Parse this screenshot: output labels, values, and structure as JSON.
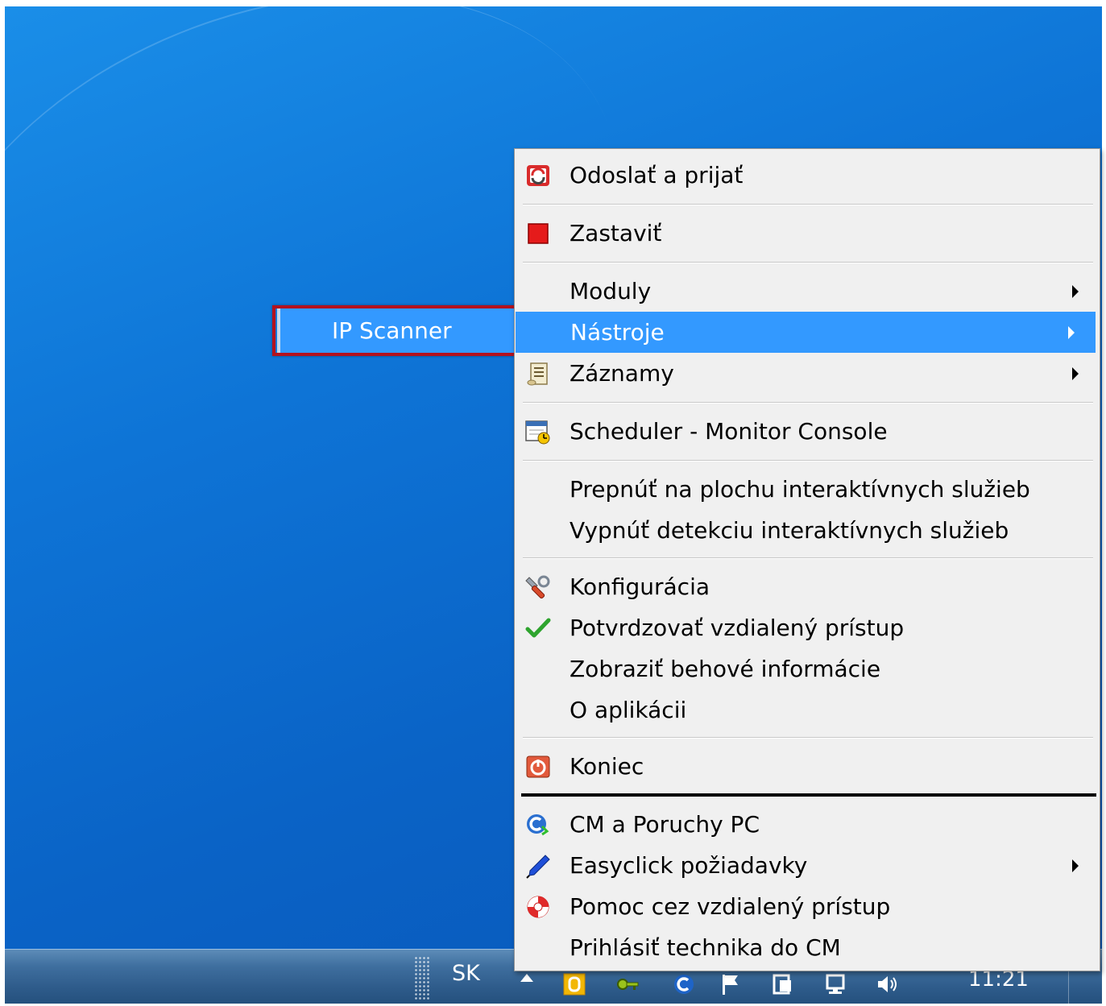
{
  "desktop": {
    "colors": {
      "background": "#0e74d6",
      "menu_bg": "#f0f0f0",
      "highlight": "#3399ff",
      "callout": "#b3121e"
    }
  },
  "taskbar": {
    "language": "SK",
    "clock": "11:21",
    "tray_icons": [
      "office-tray-icon",
      "key-tray-icon",
      "c-tray-icon",
      "flag-tray-icon",
      "device-tray-icon",
      "network-tray-icon",
      "volume-tray-icon"
    ]
  },
  "context_menu": {
    "items": [
      {
        "label": "Odoslať a prijať",
        "icon": "send-receive-icon"
      },
      {
        "label": "Zastaviť",
        "icon": "stop-icon"
      },
      {
        "label": "Moduly",
        "submenu": true
      },
      {
        "label": "Nástroje",
        "submenu": true,
        "highlighted": true
      },
      {
        "label": "Záznamy",
        "icon": "scroll-icon",
        "submenu": true
      },
      {
        "label": "Scheduler - Monitor Console",
        "icon": "scheduler-icon"
      },
      {
        "label": "Prepnúť na plochu interaktívnych služieb"
      },
      {
        "label": "Vypnúť detekciu interaktívnych služieb"
      },
      {
        "label": "Konfigurácia",
        "icon": "tools-icon"
      },
      {
        "label": "Potvrdzovať vzdialený prístup",
        "icon": "checkmark-icon"
      },
      {
        "label": "Zobraziť behové informácie"
      },
      {
        "label": "O aplikácii"
      },
      {
        "label": "Koniec",
        "icon": "power-icon"
      },
      {
        "label": "CM a Poruchy PC",
        "icon": "cm-icon"
      },
      {
        "label": "Easyclick požiadavky",
        "icon": "pen-icon",
        "submenu": true
      },
      {
        "label": "Pomoc cez vzdialený prístup",
        "icon": "lifebuoy-icon"
      },
      {
        "label": "Prihlásiť technika do CM"
      }
    ]
  },
  "submenu": {
    "items": [
      {
        "label": "IP Scanner"
      }
    ]
  }
}
